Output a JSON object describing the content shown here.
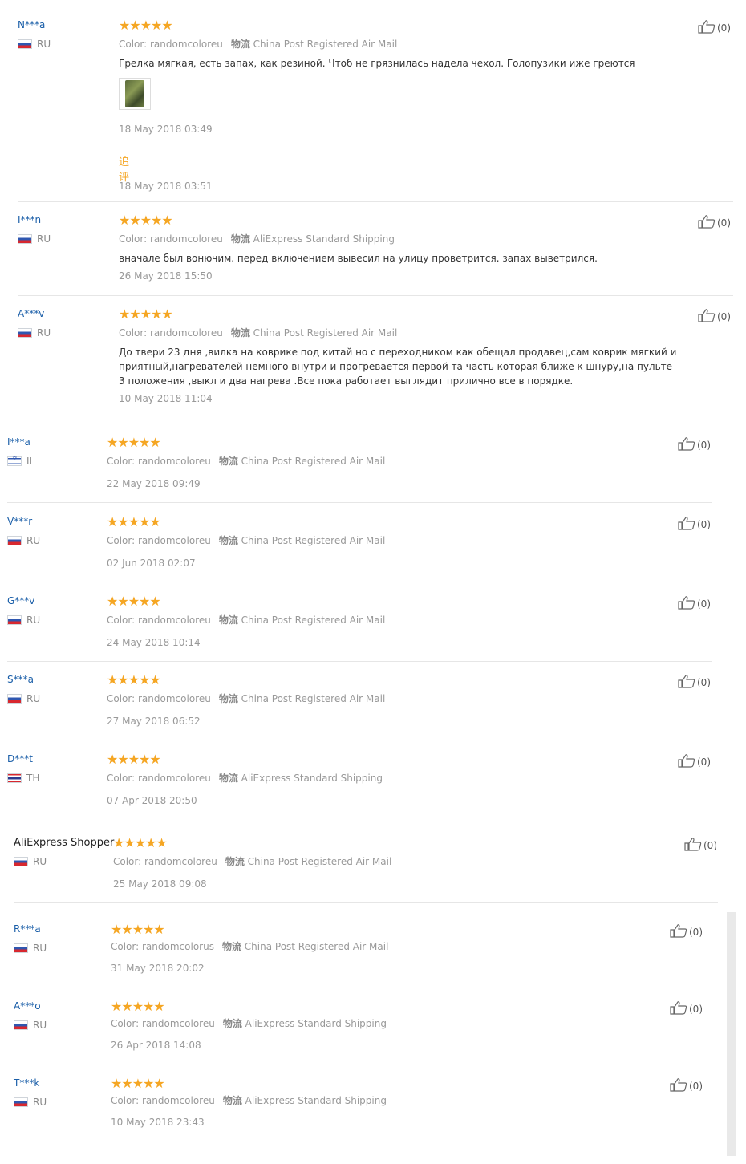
{
  "labels": {
    "color_prefix": "Color:",
    "shipping_prefix": "物流",
    "followup": "追评"
  },
  "stars": "★★★★★",
  "reviews": [
    {
      "user": "N***a",
      "country": "RU",
      "flag": "ru",
      "color": "randomcoloreu",
      "shipping": "China Post Registered Air Mail",
      "text": "Грелка мягкая, есть запах, как резиной. Чтоб не грязнилась надела чехол. Голопузики иже греются",
      "date": "18 May 2018 03:49",
      "followup_date": "18 May 2018 03:51",
      "likes": "(0)"
    },
    {
      "user": "I***n",
      "country": "RU",
      "flag": "ru",
      "color": "randomcoloreu",
      "shipping": "AliExpress Standard Shipping",
      "text": "вначале был вонючим. перед включением вывесил на улицу проветрится. запах выветрился.",
      "date": "26 May 2018 15:50",
      "likes": "(0)"
    },
    {
      "user": "A***v",
      "country": "RU",
      "flag": "ru",
      "color": "randomcoloreu",
      "shipping": "China Post Registered Air Mail",
      "text": "До твери 23 дня ,вилка на коврике под китай но с переходником как обещал продавец,сам коврик мягкий и приятный,нагревателей немного внутри и прогревается первой та часть которая ближе к шнуру,на пульте 3 положения ,выкл и два нагрева .Все пока работает выглядит прилично все в порядке.",
      "date": "10 May 2018 11:04",
      "likes": "(0)"
    },
    {
      "user": "I***a",
      "country": "IL",
      "flag": "il",
      "color": "randomcoloreu",
      "shipping": "China Post Registered Air Mail",
      "date": "22 May 2018 09:49",
      "likes": "(0)"
    },
    {
      "user": "V***r",
      "country": "RU",
      "flag": "ru",
      "color": "randomcoloreu",
      "shipping": "China Post Registered Air Mail",
      "date": "02 Jun 2018 02:07",
      "likes": "(0)"
    },
    {
      "user": "G***v",
      "country": "RU",
      "flag": "ru",
      "color": "randomcoloreu",
      "shipping": "China Post Registered Air Mail",
      "date": "24 May 2018 10:14",
      "likes": "(0)"
    },
    {
      "user": "S***a",
      "country": "RU",
      "flag": "ru",
      "color": "randomcoloreu",
      "shipping": "China Post Registered Air Mail",
      "date": "27 May 2018 06:52",
      "likes": "(0)"
    },
    {
      "user": "D***t",
      "country": "TH",
      "flag": "th",
      "color": "randomcoloreu",
      "shipping": "AliExpress Standard Shipping",
      "date": "07 Apr 2018 20:50",
      "likes": "(0)"
    },
    {
      "user": "AliExpress Shopper",
      "country": "RU",
      "flag": "ru",
      "color": "randomcoloreu",
      "shipping": "China Post Registered Air Mail",
      "date": "25 May 2018 09:08",
      "likes": "(0)"
    },
    {
      "user": "R***a",
      "country": "RU",
      "flag": "ru",
      "color": "randomcolorus",
      "shipping": "China Post Registered Air Mail",
      "date": "31 May 2018 20:02",
      "likes": "(0)"
    },
    {
      "user": "A***o",
      "country": "RU",
      "flag": "ru",
      "color": "randomcoloreu",
      "shipping": "AliExpress Standard Shipping",
      "date": "26 Apr 2018 14:08",
      "likes": "(0)"
    },
    {
      "user": "T***k",
      "country": "RU",
      "flag": "ru",
      "color": "randomcoloreu",
      "shipping": "AliExpress Standard Shipping",
      "date": "10 May 2018 23:43",
      "likes": "(0)"
    }
  ]
}
